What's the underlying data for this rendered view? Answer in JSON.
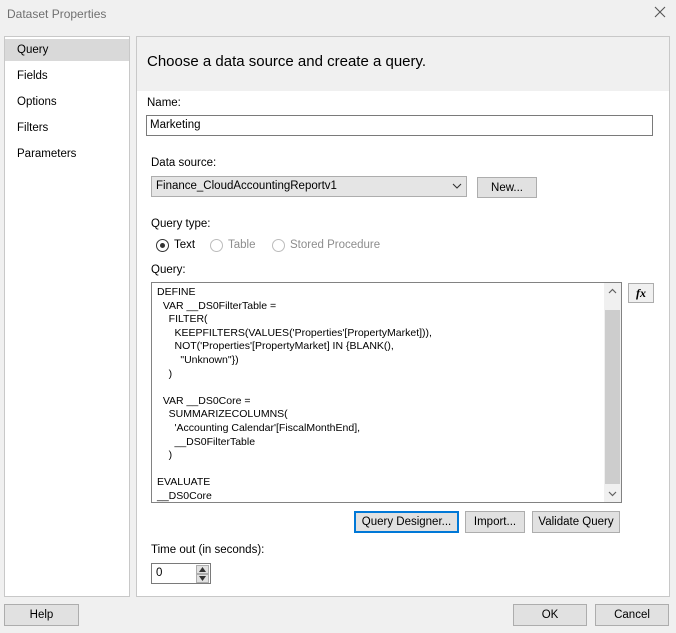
{
  "window": {
    "title": "Dataset Properties"
  },
  "sidebar": {
    "items": [
      {
        "label": "Query",
        "selected": true
      },
      {
        "label": "Fields",
        "selected": false
      },
      {
        "label": "Options",
        "selected": false
      },
      {
        "label": "Filters",
        "selected": false
      },
      {
        "label": "Parameters",
        "selected": false
      }
    ]
  },
  "content": {
    "header": "Choose a data source and create a query.",
    "name_label": "Name:",
    "name_value": "Marketing",
    "datasource_label": "Data source:",
    "datasource_value": "Finance_CloudAccountingReportv1",
    "new_button": "New...",
    "querytype_label": "Query type:",
    "querytype_options": [
      {
        "label": "Text",
        "checked": true,
        "enabled": true
      },
      {
        "label": "Table",
        "checked": false,
        "enabled": false
      },
      {
        "label": "Stored Procedure",
        "checked": false,
        "enabled": false
      }
    ],
    "query_label": "Query:",
    "query_text": "DEFINE\n  VAR __DS0FilterTable =\n    FILTER(\n      KEEPFILTERS(VALUES('Properties'[PropertyMarket])),\n      NOT('Properties'[PropertyMarket] IN {BLANK(),\n        \"Unknown\"})\n    )\n\n  VAR __DS0Core =\n    SUMMARIZECOLUMNS(\n      'Accounting Calendar'[FiscalMonthEnd],\n      __DS0FilterTable\n    )\n\nEVALUATE\n__DS0Core",
    "expression_button": "fx",
    "query_designer_button": "Query Designer...",
    "import_button": "Import...",
    "validate_button": "Validate Query",
    "timeout_label": "Time out (in seconds):",
    "timeout_value": "0"
  },
  "footer": {
    "help_button": "Help",
    "ok_button": "OK",
    "cancel_button": "Cancel"
  }
}
